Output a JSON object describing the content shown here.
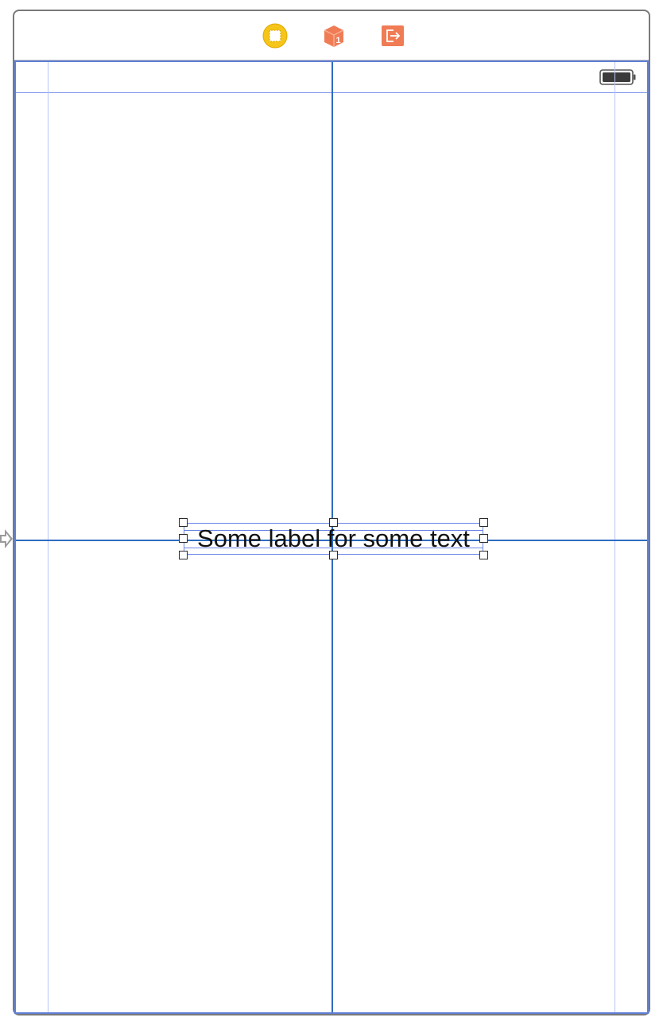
{
  "scene": {
    "dock_icons": [
      {
        "name": "view-controller-icon",
        "color": "#f5c518"
      },
      {
        "name": "first-responder-icon",
        "color": "#f07d56"
      },
      {
        "name": "exit-icon",
        "color": "#f07d56"
      }
    ],
    "status_bar": {
      "battery_icon": "battery-icon"
    }
  },
  "label": {
    "text": "Some label for some text"
  },
  "colors": {
    "guide": "#2f6cbf",
    "selection": "#6a86e8",
    "margin_guide": "#b7c6f5"
  }
}
